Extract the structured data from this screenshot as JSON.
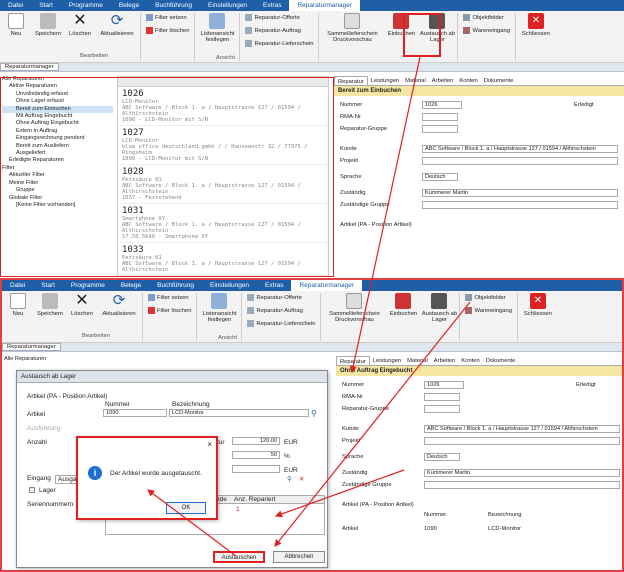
{
  "menu": [
    "Datei",
    "Start",
    "Programme",
    "Belege",
    "Buchführung",
    "Einstellungen",
    "Extras",
    "Reparaturmanager"
  ],
  "ribbon": {
    "neu": "Neu",
    "speichern": "Speichern",
    "loeschen": "Löschen",
    "aktualisieren": "Aktualisieren",
    "filter_setzen": "Filter setzen",
    "filter_loeschen": "Filter löschen",
    "listenansicht": "Listenansicht festlegen",
    "ansicht_group": "Ansicht",
    "bearbeiten_group": "Bearbeiten",
    "rep_offerte": "Reparatur-Offerte",
    "rep_auftrag": "Reparatur-Auftrag",
    "rep_lieferschein": "Reparatur-Lieferschein",
    "sammel": "Sammellieferschein Druckvorschau",
    "einbuchen": "Einbuchen",
    "austausch": "Austausch ab Lager",
    "objektfelder": "Objektfelder",
    "wareneingang": "Wareneingang",
    "schliessen": "Schliessen"
  },
  "module_tab": "Reparaturmanager",
  "tree": [
    "Alle Reparaturen",
    "Aktive Reparaturen",
    "Unvollständig erfasst",
    "Ohne Lager erfasst",
    "Bereit zum Einbuchen",
    "Mit Auftrag Eingebucht",
    "Ohne Auftrag Eingebucht",
    "Extern in Auftrag",
    "Eingangsrechnung pendent",
    "Bereit zum Ausliefern",
    "Ausgeliefert",
    "Erledigte Reparaturen",
    "Filter",
    "Aktueller Filter",
    "Meine Filter",
    "Gruppe",
    "Globale Filter",
    "[Keine Filter vorhanden]"
  ],
  "list": [
    {
      "num": "1026",
      "l1": "LCD-Monitor",
      "l2": "ABC Software / Block 1. a / Hauptstrasse 127 / 01594 / Althirschstein",
      "l3": "1090 - LCD-Monitor mit S/N"
    },
    {
      "num": "1027",
      "l1": "LCD-Monitor",
      "l2": "blue office deutschland.gmbh / / Hauseenstr 32 / 77975 / Ringsheim",
      "l3": "1090 - LCD-Monitor mit S/N"
    },
    {
      "num": "1028",
      "l1": "Pettsäure 01",
      "l2": "ABC Software / Block 1. a / Hauptstrasse 127 / 01594 / Althirschstein",
      "l3": "1037 - Feststehend"
    },
    {
      "num": "1031",
      "l1": "Smartphone XY",
      "l2": "ABC Software / Block 1. a / Hauptstrasse 127 / 01594 / Althirschstein",
      "l3": "17.50.5640 - Smartphone XY"
    },
    {
      "num": "1033",
      "l1": "Pettsäure 01",
      "l2": "ABC Software / Block 1. a / Hauptstrasse 127 / 01594 / Althirschstein",
      "l3": ""
    }
  ],
  "detail_tabs": [
    "Reparatur",
    "Leistungen",
    "Material",
    "Arbeiten",
    "Konten",
    "Dokumente"
  ],
  "detail1": {
    "title": "Bereit zum Einbuchen"
  },
  "detail2": {
    "title": "Ohne Auftrag Eingebucht"
  },
  "fields": {
    "nummer_lbl": "Nummer",
    "nummer": "1026",
    "erledigt": "Erledigt",
    "rma": "RMA-Nr",
    "gruppe": "Reparatur-Gruppe",
    "kunde_lbl": "Kunde",
    "kunde": "ABC Software / Block 1. a / Hauptstrasse 127 / 01594 / Althirschstein",
    "projekt": "Projekt",
    "sprache_lbl": "Sprache",
    "sprache": "Deutsch",
    "zustaendig": "Zuständig",
    "zustaendig_val": "Kummerer Martin",
    "zust_gruppe": "Zuständige Gruppe",
    "artikel_pa": "Artikel (PA - Position Artikel)",
    "nummer_col": "Nummer",
    "bez_col": "Bezeichnung",
    "artikel": "Artikel",
    "artikel_num": "1090",
    "artikel_bez": "LCD-Monitor"
  },
  "dialog": {
    "title": "Austausch ab Lager",
    "section": "Artikel (PA - Position Artikel)",
    "nummer": "Nummer",
    "bez": "Bezeichnung",
    "artikel": "Artikel",
    "art_num": "1090",
    "art_bez": "LCD-Monitor",
    "ausfuehrung": "Ausführung",
    "anzahl": "Anzahl",
    "tur": "tur",
    "price": "120.00",
    "eur": "EUR",
    "pct": "50",
    "pctsign": "%",
    "eur2": "EUR",
    "eingang": "Eingang",
    "ausga": "Ausga",
    "lager": "Lager",
    "seriennummern": "Seriennummern",
    "col1": "nde",
    "col2": "Anz. Repariert",
    "row_val": "1",
    "austauschen": "Austauschen",
    "abbrechen": "Abbrechen"
  },
  "message": {
    "text": "Der Artikel wurde ausgetauscht.",
    "ok": "OK",
    "close": "×"
  },
  "colors": {
    "menubar": "#1e5fa8",
    "highlight": "#e02020",
    "statusbar": "#f5e6a4"
  }
}
